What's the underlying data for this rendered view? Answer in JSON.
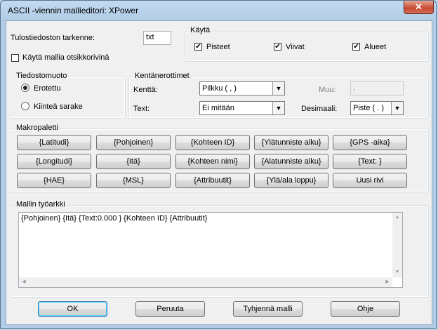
{
  "window": {
    "title": "ASCII -viennin mallieditori: XPower",
    "close_glyph": "✕"
  },
  "output": {
    "extension_label": "Tulostiedoston tarkenne:",
    "extension_value": "txt",
    "header_checkbox_label": "Käytä mallia otsikkorivinä",
    "header_checked": false
  },
  "use": {
    "title": "Käytä",
    "points": {
      "label": "Pisteet",
      "checked": true
    },
    "lines": {
      "label": "Viivat",
      "checked": true
    },
    "areas": {
      "label": "Alueet",
      "checked": true
    }
  },
  "file_format": {
    "title": "Tiedostomuoto",
    "delimited": {
      "label": "Erotettu",
      "selected": true
    },
    "fixed": {
      "label": "Kiinteä sarake",
      "selected": false
    }
  },
  "field_delimiters": {
    "title": "Kentänerottimet",
    "field_label": "Kenttä:",
    "field_value": "Pilkku ( , )",
    "other_label": "Muu:",
    "other_value": ",",
    "text_label": "Text:",
    "text_value": "Ei mitään",
    "decimal_label": "Desimaali:",
    "decimal_value": "Piste ( . )"
  },
  "macro_palette": {
    "title": "Makropaletti",
    "buttons": [
      "{Latitudi}",
      "{Pohjoinen}",
      "{Kohteen ID}",
      "{Ylätunniste alku}",
      "{GPS -aika}",
      "{Longitudi}",
      "{Itä}",
      "{Kohteen nimi}",
      "{Alatunniste alku}",
      "{Text: }",
      "{HAE}",
      "{MSL}",
      "{Attribuutit}",
      "{Ylä/ala loppu}",
      "Uusi rivi"
    ]
  },
  "workbench": {
    "title": "Mallin työarkki",
    "content": "{Pohjoinen} {Itä} {Text:0.000 } {Kohteen ID} {Attribuutit}"
  },
  "footer": {
    "ok": "OK",
    "cancel": "Peruuta",
    "clear": "Tyhjennä malli",
    "help": "Ohje"
  },
  "icons": {
    "check": "✔",
    "dropdown": "▼",
    "scroll_up": "▲",
    "scroll_down": "▼",
    "scroll_left": "◀",
    "scroll_right": "▶"
  }
}
